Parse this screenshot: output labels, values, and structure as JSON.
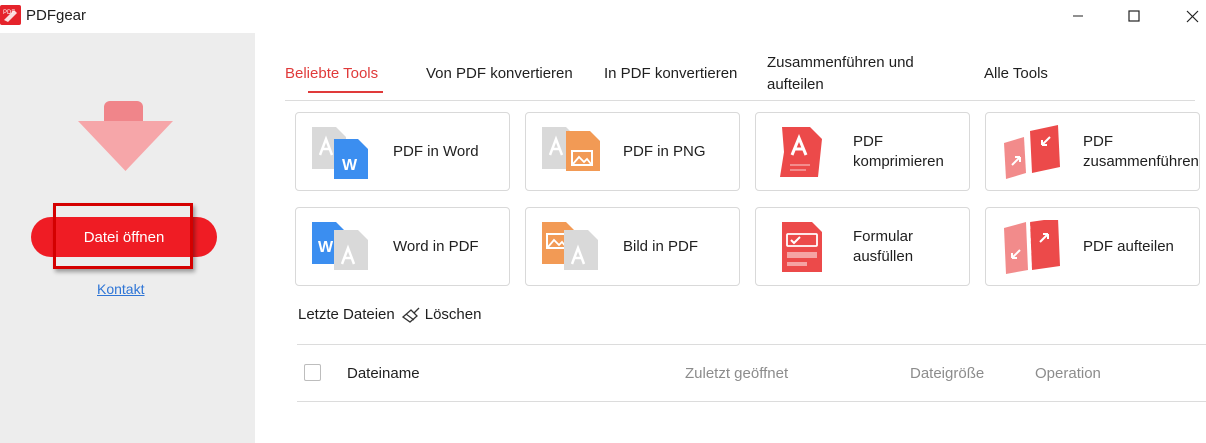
{
  "window": {
    "title": "PDFgear",
    "logo_text": "PDF",
    "controls": {
      "minimize": "minimize-icon",
      "maximize": "maximize-icon",
      "close": "close-icon"
    }
  },
  "sidebar": {
    "open_button_label": "Datei öffnen",
    "contact_link": "Kontakt"
  },
  "tabs": [
    {
      "label": "Beliebte Tools",
      "active": true
    },
    {
      "label": "Von PDF konvertieren",
      "active": false
    },
    {
      "label": "In PDF konvertieren",
      "active": false
    },
    {
      "label": "Zusammenführen und\naufteilen",
      "active": false
    },
    {
      "label": "Alle Tools",
      "active": false
    }
  ],
  "tools": [
    {
      "label": "PDF in Word",
      "icon": "pdf-to-word-icon"
    },
    {
      "label": "PDF in PNG",
      "icon": "pdf-to-png-icon"
    },
    {
      "label": "PDF\nkomprimieren",
      "icon": "compress-pdf-icon"
    },
    {
      "label": "PDF\nzusammenführen",
      "icon": "merge-pdf-icon"
    },
    {
      "label": "Word in PDF",
      "icon": "word-to-pdf-icon"
    },
    {
      "label": "Bild in PDF",
      "icon": "image-to-pdf-icon"
    },
    {
      "label": "Formular\nausfüllen",
      "icon": "fill-form-icon"
    },
    {
      "label": "PDF aufteilen",
      "icon": "split-pdf-icon"
    }
  ],
  "recent": {
    "title": "Letzte Dateien",
    "clear_label": "Löschen",
    "columns": [
      "Dateiname",
      "Zuletzt geöffnet",
      "Dateigröße",
      "Operation"
    ]
  },
  "colors": {
    "brand_red": "#ef1c24",
    "accent_tab": "#e03a3a",
    "pdf_gray": "#d6d6d6",
    "word_blue": "#3b8ef0",
    "image_orange": "#f29a55",
    "tool_red": "#ec4a4a",
    "link_blue": "#2e75d6"
  }
}
